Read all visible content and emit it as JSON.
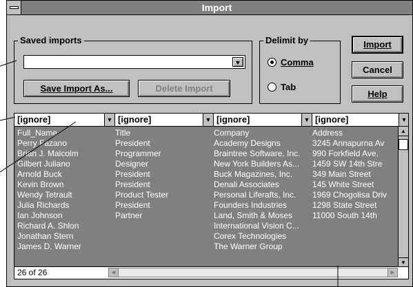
{
  "window": {
    "title": "Import"
  },
  "saved_imports": {
    "label": "Saved imports",
    "value": "",
    "save_as_label": "Save Import As...",
    "delete_label": "Delete Import"
  },
  "delimit": {
    "label": "Delimit by",
    "options": [
      {
        "label": "Comma",
        "selected": true
      },
      {
        "label": "Tab",
        "selected": false
      }
    ]
  },
  "buttons": {
    "import": "Import",
    "cancel": "Cancel",
    "help": "Help"
  },
  "grid": {
    "columns": [
      "[ignore]",
      "[ignore]",
      "[ignore]",
      "[ignore]"
    ],
    "rows": [
      [
        "Full_Name",
        "Title",
        "Company",
        "Address"
      ],
      [
        "Perry Fazano",
        "President",
        "Academy Designs",
        "3245 Annapurna Av"
      ],
      [
        "Brian J. Malcolm",
        "Programmer",
        "Braintree Software, Inc.",
        "990 Forkfield Ave."
      ],
      [
        "Gilbert Juliano",
        "Designer",
        "New York Builders As...",
        "1459 SW 14th Stre"
      ],
      [
        "Arnold Buck",
        "President",
        "Buck Magazines, Inc.",
        "349 Main Street"
      ],
      [
        "Kevin Brown",
        "President",
        "Denali Associates",
        "145 White Street"
      ],
      [
        "Wendy Tetrault",
        "Product Tester",
        "Personal Liferafts, Inc.",
        "1969 Chogolisa Driv"
      ],
      [
        "Julia Richards",
        "President",
        "Founders Industries",
        "1298 State Street"
      ],
      [
        "Ian Johnson",
        "Partner",
        "Land, Smith & Moses",
        "11000 South 14th"
      ],
      [
        "Richard A. Shlon",
        "",
        "International Vision C...",
        ""
      ],
      [
        "Jonathan Stern",
        "",
        "Corex Technologies",
        ""
      ],
      [
        "James D. Warner",
        "",
        "The Warner Group",
        ""
      ]
    ],
    "record_count": "26 of 26"
  }
}
